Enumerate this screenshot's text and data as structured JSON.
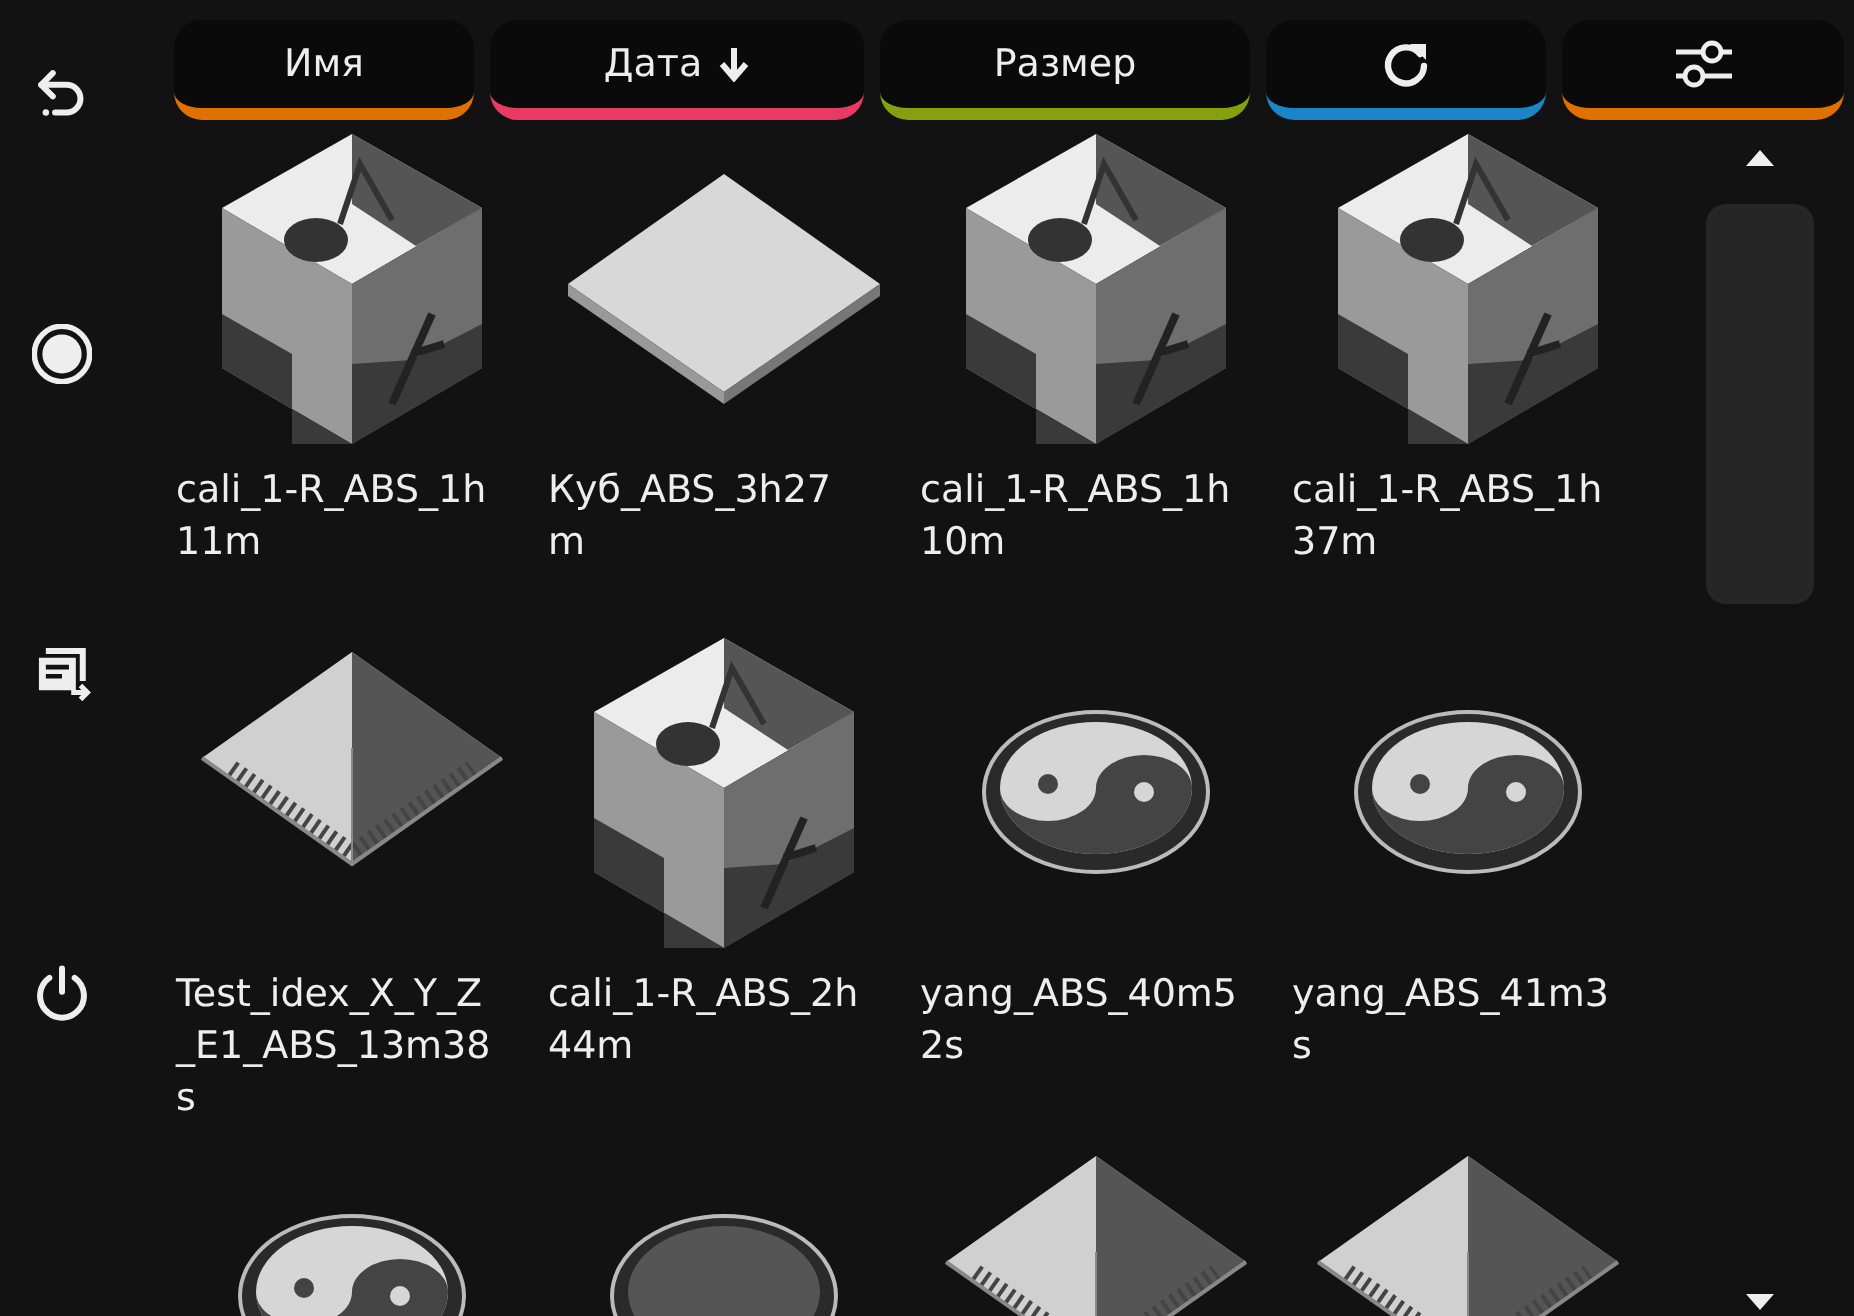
{
  "sidebar": {
    "items": [
      {
        "kind": "back"
      },
      {
        "kind": "record"
      },
      {
        "kind": "queue"
      },
      {
        "kind": "power"
      }
    ]
  },
  "sort_bar": {
    "buttons": [
      {
        "kind": "text",
        "label": "Имя",
        "color": "#e07000"
      },
      {
        "kind": "text",
        "label": "Дата",
        "sorted": true,
        "color": "#e83a62"
      },
      {
        "kind": "text",
        "label": "Размер",
        "color": "#86a010"
      },
      {
        "kind": "refresh",
        "color": "#1a86c8"
      },
      {
        "kind": "filter",
        "color": "#e07000"
      }
    ]
  },
  "files": [
    {
      "kind": "cube",
      "name": "cali_1-R_ABS_1h11m"
    },
    {
      "kind": "plate",
      "name": "Куб_ABS_3h27m"
    },
    {
      "kind": "cube",
      "name": "cali_1-R_ABS_1h10m"
    },
    {
      "kind": "cube",
      "name": "cali_1-R_ABS_1h37m"
    },
    {
      "kind": "calib",
      "name": "Test_idex_X_Y_Z_E1_ABS_13m38s"
    },
    {
      "kind": "cube",
      "name": "cali_1-R_ABS_2h44m"
    },
    {
      "kind": "yinyang",
      "name": "yang_ABS_40m52s"
    },
    {
      "kind": "yinyang",
      "name": "yang_ABS_41m3s"
    },
    {
      "kind": "yinyang"
    },
    {
      "kind": "disc"
    },
    {
      "kind": "calib"
    },
    {
      "kind": "calib"
    }
  ]
}
